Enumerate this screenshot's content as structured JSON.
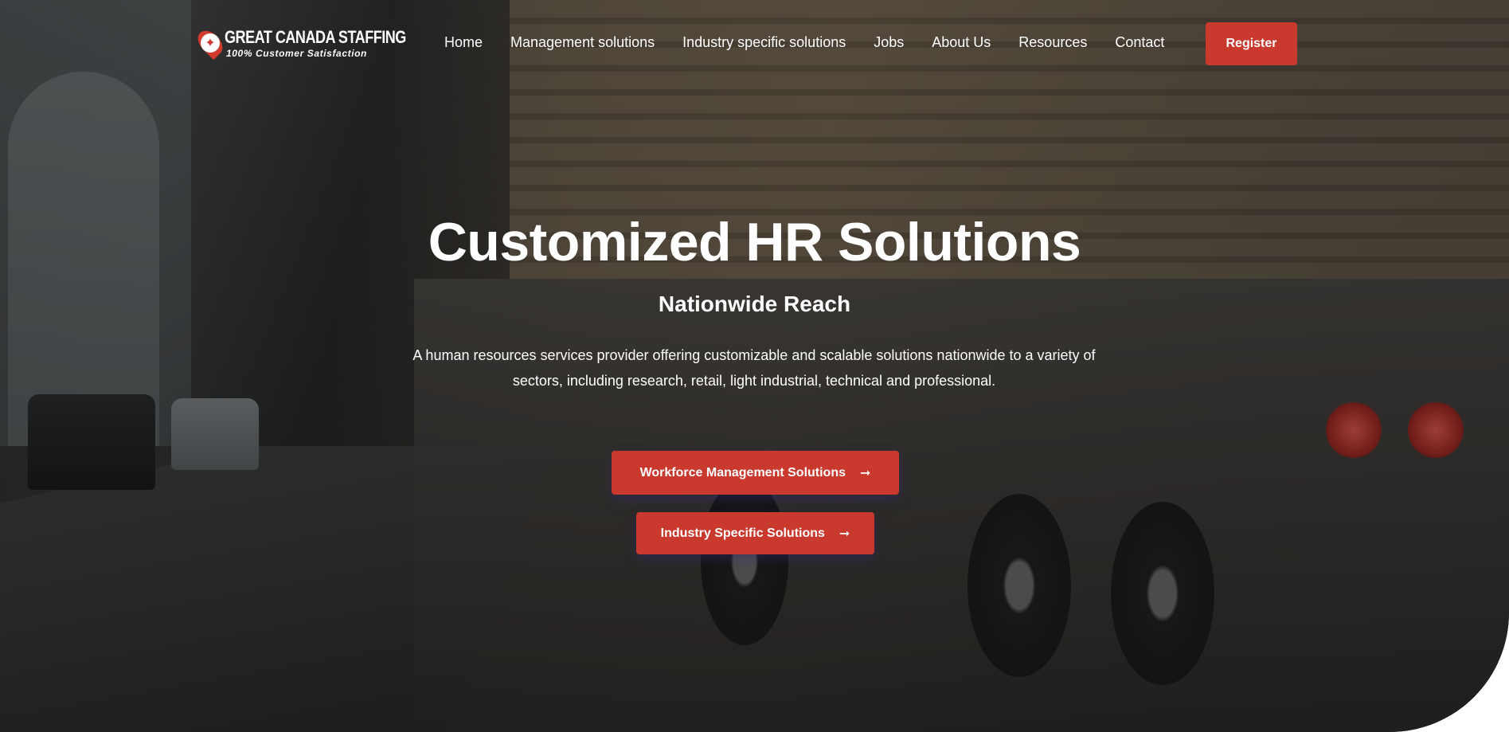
{
  "header": {
    "logo": {
      "name": "GREAT CANADA STAFFING",
      "tagline": "100% Customer Satisfaction"
    },
    "nav": [
      {
        "label": "Home"
      },
      {
        "label": "Management solutions"
      },
      {
        "label": "Industry specific solutions"
      },
      {
        "label": "Jobs"
      },
      {
        "label": "About Us"
      },
      {
        "label": "Resources"
      },
      {
        "label": "Contact"
      }
    ],
    "register_label": "Register"
  },
  "hero": {
    "title": "Customized HR Solutions",
    "subtitle": "Nationwide Reach",
    "description": "A human resources services provider offering customizable and scalable solutions nationwide to a variety of sectors, including research, retail, light industrial, technical and professional.",
    "buttons": [
      {
        "label": "Workforce Management Solutions",
        "icon": "arrow-right-icon"
      },
      {
        "label": "Industry Specific Solutions",
        "icon": "arrow-right-icon"
      }
    ]
  },
  "colors": {
    "accent": "#c9392e",
    "text": "#ffffff"
  }
}
